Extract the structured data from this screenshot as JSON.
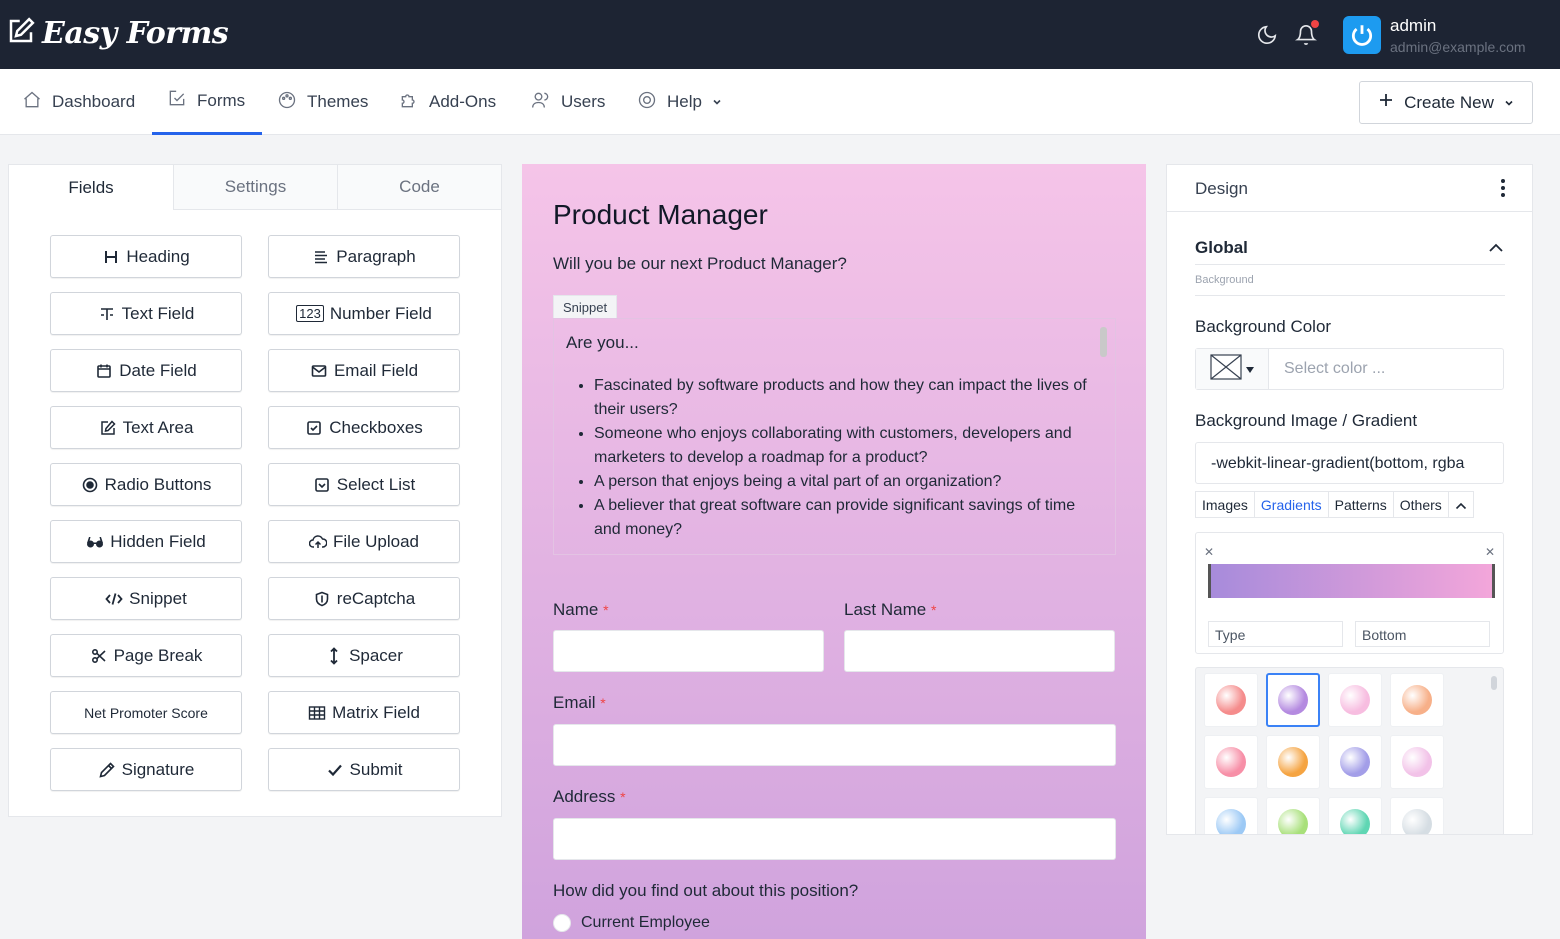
{
  "brand": {
    "name": "Easy Forms"
  },
  "user": {
    "name": "admin",
    "email": "admin@example.com"
  },
  "nav": {
    "items": [
      {
        "label": "Dashboard"
      },
      {
        "label": "Forms"
      },
      {
        "label": "Themes"
      },
      {
        "label": "Add-Ons"
      },
      {
        "label": "Users"
      },
      {
        "label": "Help"
      }
    ],
    "active": "Forms",
    "create_label": "Create New"
  },
  "left_panel": {
    "tabs": [
      "Fields",
      "Settings",
      "Code"
    ],
    "active_tab": "Fields",
    "fields": [
      {
        "label": "Heading",
        "icon": "heading-icon"
      },
      {
        "label": "Paragraph",
        "icon": "paragraph-icon"
      },
      {
        "label": "Text Field",
        "icon": "text-field-icon"
      },
      {
        "label": "Number Field",
        "icon": "number-icon"
      },
      {
        "label": "Date Field",
        "icon": "calendar-icon"
      },
      {
        "label": "Email Field",
        "icon": "envelope-icon"
      },
      {
        "label": "Text Area",
        "icon": "edit-icon"
      },
      {
        "label": "Checkboxes",
        "icon": "checkbox-icon"
      },
      {
        "label": "Radio Buttons",
        "icon": "radio-icon"
      },
      {
        "label": "Select List",
        "icon": "select-icon"
      },
      {
        "label": "Hidden Field",
        "icon": "glasses-icon"
      },
      {
        "label": "File Upload",
        "icon": "cloud-upload-icon"
      },
      {
        "label": "Snippet",
        "icon": "code-icon"
      },
      {
        "label": "reCaptcha",
        "icon": "shield-icon"
      },
      {
        "label": "Page Break",
        "icon": "scissors-icon"
      },
      {
        "label": "Spacer",
        "icon": "vertical-arrows-icon"
      },
      {
        "label": "Net Promoter Score",
        "icon": ""
      },
      {
        "label": "Matrix Field",
        "icon": "table-icon"
      },
      {
        "label": "Signature",
        "icon": "pen-icon"
      },
      {
        "label": "Submit",
        "icon": "check-icon"
      }
    ]
  },
  "form": {
    "title": "Product Manager",
    "subtitle": "Will you be our next Product Manager?",
    "snippet_tag": "Snippet",
    "snippet_heading": "Are you...",
    "snippet_items": [
      "Fascinated by software products and how they can impact the lives of their users?",
      "Someone who enjoys collaborating with customers, developers and marketers to develop a roadmap for a product?",
      "A person that enjoys being a vital part of an organization?",
      "A believer that great software can provide significant savings of time and money?"
    ],
    "fields": {
      "name": {
        "label": "Name",
        "required": "*"
      },
      "last_name": {
        "label": "Last Name",
        "required": "*"
      },
      "email": {
        "label": "Email",
        "required": "*"
      },
      "address": {
        "label": "Address",
        "required": "*"
      }
    },
    "question": "How did you find out about this position?",
    "options": [
      "Current Employee"
    ],
    "background_colors": {
      "top": "#f5c4e8",
      "bottom": "#d0a3dd"
    }
  },
  "design": {
    "title": "Design",
    "section": "Global",
    "section_sub": "Background",
    "bg_color_label": "Background Color",
    "bg_color_placeholder": "Select color ...",
    "bg_image_label": "Background Image / Gradient",
    "bg_image_value": "-webkit-linear-gradient(bottom, rgba",
    "gradient_tabs": [
      "Images",
      "Gradients",
      "Patterns",
      "Others"
    ],
    "active_gradient_tab": "Gradients",
    "gradient_type_placeholder": "Type",
    "gradient_direction": "Bottom",
    "gradient_colors": [
      "#a78bdb",
      "#f3a6da"
    ],
    "presets": [
      {
        "color": "#f58c8c",
        "selected": false
      },
      {
        "color": "#b48ae0",
        "selected": true
      },
      {
        "color": "#f7bde0",
        "selected": false
      },
      {
        "color": "#f7b089",
        "selected": false
      },
      {
        "color": "#f78fa7",
        "selected": false
      },
      {
        "color": "#f5a442",
        "selected": false
      },
      {
        "color": "#a39ee8",
        "selected": false
      },
      {
        "color": "#f2c2e8",
        "selected": false
      },
      {
        "color": "#9cc9f5",
        "selected": false
      },
      {
        "color": "#a8e07a",
        "selected": false
      },
      {
        "color": "#5fd6b3",
        "selected": false
      },
      {
        "color": "#d5dde3",
        "selected": false
      }
    ]
  }
}
